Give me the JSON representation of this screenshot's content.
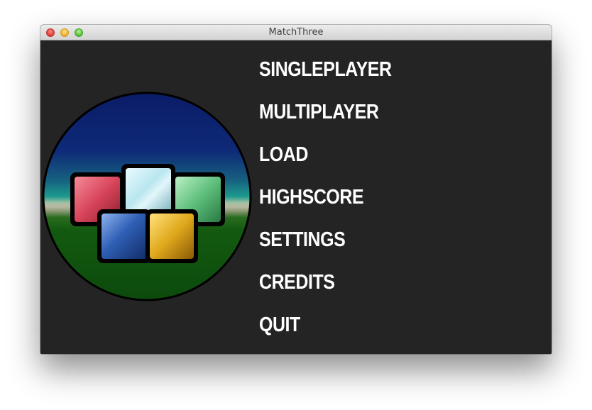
{
  "window": {
    "title": "MatchThree"
  },
  "menu": {
    "items": [
      {
        "label": "SINGLEPLAYER"
      },
      {
        "label": "MULTIPLAYER"
      },
      {
        "label": "LOAD"
      },
      {
        "label": "HIGHSCORE"
      },
      {
        "label": "SETTINGS"
      },
      {
        "label": "CREDITS"
      },
      {
        "label": "QUIT"
      }
    ]
  },
  "colors": {
    "background": "#242424",
    "menu_text": "#ffffff",
    "sky": "#0d1f6b",
    "horizon": "#1f8c8c",
    "ground": "#0f520f",
    "tile_red": "#d8455a",
    "tile_cyan": "#b9e6ef",
    "tile_green": "#5fbf7c",
    "tile_blue": "#2f5fb5",
    "tile_yellow": "#e0a81c"
  }
}
